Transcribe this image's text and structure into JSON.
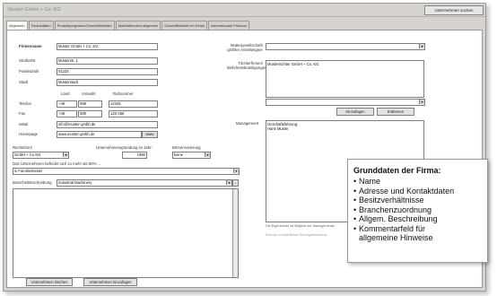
{
  "window": {
    "title": "Muster GmbH + Co. KG",
    "search_button": "Unternehmen suchen"
  },
  "tabs": [
    {
      "label": "Allgemein"
    },
    {
      "label": "Finanzdaten"
    },
    {
      "label": "Produktprogramm/Geschäftsfelder"
    },
    {
      "label": "Marktübersicht allgemein"
    },
    {
      "label": "Geschäftsfelder im Detail"
    },
    {
      "label": "Internationale Präsenz"
    }
  ],
  "form": {
    "firmenname_label": "Firmenname",
    "firmenname_value": "Muster GmbH + Co. KG",
    "strasse_label": "Straße/Nr.",
    "strasse_value": "Musterstr. 1",
    "plz_label": "Postleitzahl",
    "plz_value": "01234",
    "stadt_label": "Stadt",
    "stadt_value": "Musterstadt",
    "col_land": "Land",
    "col_vorwahl": "Vorwahl",
    "col_rufnummer": "Rufnummer",
    "telefon_label": "Telefon",
    "telefon_land": "+49",
    "telefon_vorwahl": "089",
    "telefon_nummer": "12345",
    "fax_label": "Fax",
    "fax_land": "+49",
    "fax_vorwahl": "089",
    "fax_nummer": "123-456",
    "email_label": "eMail",
    "email_value": "info@muster-gmbh.de",
    "homepage_label": "Homepage",
    "homepage_value": "www.muster-gmbh.de",
    "homepage_btn": "www",
    "rechtsform_label": "Rechtsform",
    "rechtsform_value": "GmbH + Co KG",
    "gruendung_label": "Unternehmensgründung im Jahr:",
    "gruendung_value": "1980",
    "boerse_label": "Börsennotierung",
    "boerse_value": "keine",
    "streubesitz_label": "Das Unternehmen befindet sich zu mehr als 50% ...",
    "streubesitz_value": "in Familienbesitz",
    "branche_label": "Branche/Beschreibung",
    "branche_value": "Industrial Machinery",
    "mutter_label": "Muttergesellschaft/ größter Anteilseigner",
    "mutter_value": "",
    "tochter_label": "Töchterfirmen/ Mehrheitsbeteiligungen",
    "tochter_value": "Mustertochter GmbH + Co. KG",
    "hinzufuegen_btn": "Hinzufügen",
    "entfernen_btn": "Entfernen",
    "management_label": "Management",
    "management_line1": "Geschäftsführung:",
    "management_line2": "Hans Muster",
    "eigentuemer_check": "Die Eigentümer ist Mitglied der Managements",
    "extra_label": "Externe Vorsitz/Beirat Sitzungsteilnahme",
    "loeschen_btn": "Unternehmen löschen",
    "neu_btn": "Unternehmen hinzufügen"
  },
  "callout": {
    "title": "Grunddaten der Firma:",
    "items": [
      "Name",
      "Adresse und Kontaktdaten",
      "Besitzverhältnisse",
      "Branchenzuordnung",
      "Allgem. Beschreibung",
      "Kommentarfeld für",
      "allgemeine Hinweise"
    ]
  }
}
